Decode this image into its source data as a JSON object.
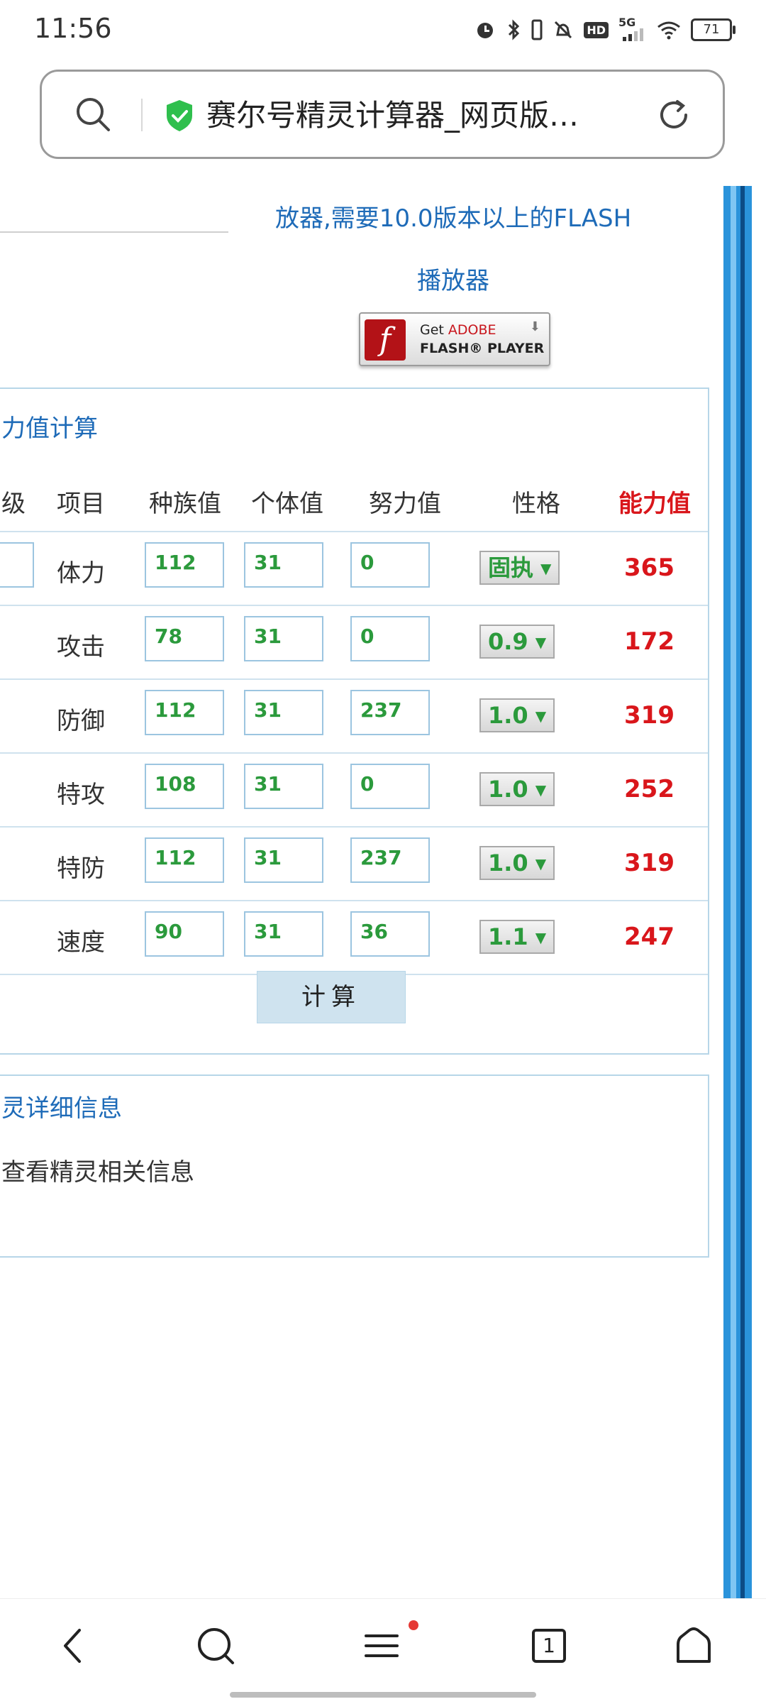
{
  "status_bar": {
    "time": "11:56",
    "network": "5G",
    "hd_label": "HD",
    "battery": "71"
  },
  "browser": {
    "url_title": "赛尔号精灵计算器_网页版…"
  },
  "page": {
    "flash_note_line1": "放器,需要10.0版本以上的FLASH",
    "flash_note_line2": "播放器",
    "flash_badge": {
      "get": "Get",
      "adobe": "ADOBE",
      "product": "FLASH® PLAYER"
    },
    "calculator": {
      "title": "力值计算",
      "headers": {
        "level": "级",
        "item": "项目",
        "race": "种族值",
        "individual": "个体值",
        "effort": "努力值",
        "nature": "性格",
        "power": "能力值"
      },
      "rows": [
        {
          "item": "体力",
          "race": "112",
          "individual": "31",
          "effort": "0",
          "nature": "固执",
          "power": "365"
        },
        {
          "item": "攻击",
          "race": "78",
          "individual": "31",
          "effort": "0",
          "nature": "0.9",
          "power": "172"
        },
        {
          "item": "防御",
          "race": "112",
          "individual": "31",
          "effort": "237",
          "nature": "1.0",
          "power": "319"
        },
        {
          "item": "特攻",
          "race": "108",
          "individual": "31",
          "effort": "0",
          "nature": "1.0",
          "power": "252"
        },
        {
          "item": "特防",
          "race": "112",
          "individual": "31",
          "effort": "237",
          "nature": "1.0",
          "power": "319"
        },
        {
          "item": "速度",
          "race": "90",
          "individual": "31",
          "effort": "36",
          "nature": "1.1",
          "power": "247"
        }
      ],
      "calc_button": "计算"
    },
    "details": {
      "title": "灵详细信息",
      "text": "查看精灵相关信息"
    }
  },
  "nav": {
    "tab_count": "1"
  }
}
